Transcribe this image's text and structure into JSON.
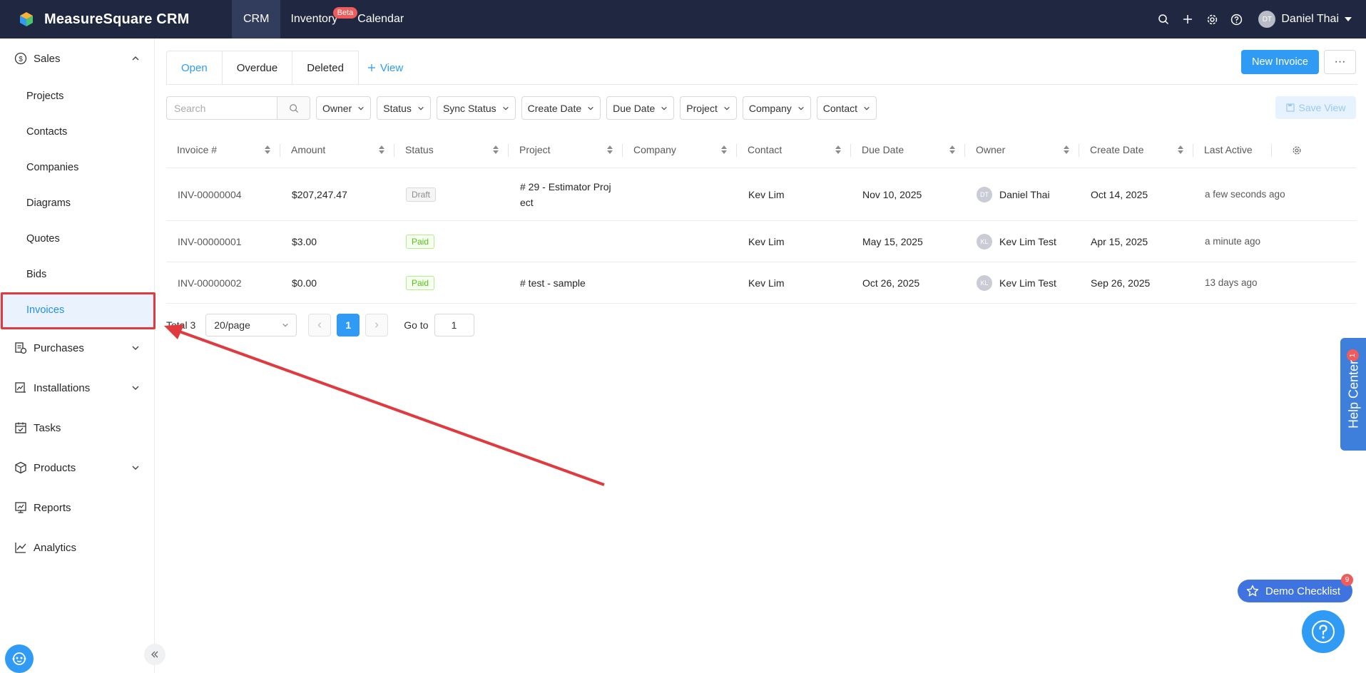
{
  "app": {
    "brand": "MeasureSquare CRM",
    "nav": [
      {
        "label": "CRM",
        "active": true
      },
      {
        "label": "Inventory",
        "badge": "Beta"
      },
      {
        "label": "Calendar"
      }
    ],
    "user": {
      "initials": "DT",
      "name": "Daniel Thai"
    }
  },
  "sidebar": {
    "sales": "Sales",
    "sales_items": [
      "Projects",
      "Contacts",
      "Companies",
      "Diagrams",
      "Quotes",
      "Bids",
      "Invoices"
    ],
    "active_item": "Invoices",
    "purchases": "Purchases",
    "installations": "Installations",
    "tasks": "Tasks",
    "products": "Products",
    "reports": "Reports",
    "analytics": "Analytics"
  },
  "tabs": {
    "items": [
      "Open",
      "Overdue",
      "Deleted"
    ],
    "active": "Open",
    "add_view": "View"
  },
  "actions": {
    "new_invoice": "New Invoice",
    "more": "···",
    "save_view": "Save View"
  },
  "filters": {
    "search_placeholder": "Search",
    "dropdowns": [
      "Owner",
      "Status",
      "Sync Status",
      "Create Date",
      "Due Date",
      "Project",
      "Company",
      "Contact"
    ]
  },
  "table": {
    "columns": [
      "Invoice #",
      "Amount",
      "Status",
      "Project",
      "Company",
      "Contact",
      "Due Date",
      "Owner",
      "Create Date",
      "Last Active"
    ],
    "rows": [
      {
        "invoice": "INV-00000004",
        "amount": "$207,247.47",
        "status": "Draft",
        "project_line1": "# 29 - Estimator Proj",
        "project_line2": "ect",
        "company": "",
        "contact": "Kev Lim",
        "due": "Nov 10, 2025",
        "owner_initials": "DT",
        "owner": "Daniel Thai",
        "created": "Oct 14, 2025",
        "last_active": "a few seconds ago"
      },
      {
        "invoice": "INV-00000001",
        "amount": "$3.00",
        "status": "Paid",
        "project_line1": "",
        "project_line2": "",
        "company": "",
        "contact": "Kev Lim",
        "due": "May 15, 2025",
        "owner_initials": "KL",
        "owner": "Kev Lim Test",
        "created": "Apr 15, 2025",
        "last_active": "a minute ago"
      },
      {
        "invoice": "INV-00000002",
        "amount": "$0.00",
        "status": "Paid",
        "project_line1": "# test - sample",
        "project_line2": "",
        "company": "",
        "contact": "Kev Lim",
        "due": "Oct 26, 2025",
        "owner_initials": "KL",
        "owner": "Kev Lim Test",
        "created": "Sep 26, 2025",
        "last_active": "13 days ago"
      }
    ]
  },
  "pagination": {
    "total": "Total 3",
    "page_size": "20/page",
    "current": "1",
    "goto_label": "Go to",
    "goto_value": "1"
  },
  "widgets": {
    "help_center": "Help Center",
    "help_badge": "1",
    "demo_checklist": "Demo Checklist",
    "demo_badge": "9"
  },
  "colors": {
    "topbar": "#1f2741",
    "accent": "#2f9bf5",
    "annotation": "#e0393e"
  }
}
